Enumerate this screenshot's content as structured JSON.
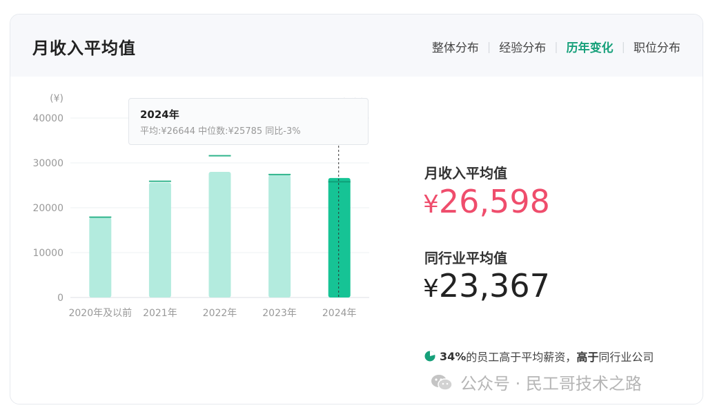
{
  "header": {
    "title": "月收入平均值",
    "tabs": [
      {
        "label": "整体分布",
        "active": false
      },
      {
        "label": "经验分布",
        "active": false
      },
      {
        "label": "历年变化",
        "active": true
      },
      {
        "label": "职位分布",
        "active": false
      }
    ]
  },
  "tooltip": {
    "title": "2024年",
    "body": "平均:¥26644  中位数:¥25785  同比-3%"
  },
  "stats": {
    "avg_label": "月收入平均值",
    "avg_value": "26,598",
    "industry_label": "同行业平均值",
    "industry_value": "23,367",
    "currency": "¥"
  },
  "note": {
    "percent": "34%",
    "text1": "的员工高于平均薪资，",
    "bold": "高于",
    "text2": "同行业公司"
  },
  "watermark": {
    "text": "公众号 · 民工哥技术之路",
    "icon": "wechat-icon"
  },
  "colors": {
    "bar": "#b3ebde",
    "bar_active": "#16c395",
    "median": "#2fb48b",
    "accent": "#16a07a",
    "avg_value": "#ef4d6c"
  },
  "chart_data": {
    "type": "bar",
    "unit": "(¥)",
    "categories": [
      "2020年及以前",
      "2021年",
      "2022年",
      "2023年",
      "2024年"
    ],
    "series": [
      {
        "values": [
          17800,
          25600,
          28000,
          27300,
          26644
        ]
      },
      {
        "name": "中位数",
        "values": [
          17900,
          25900,
          31600,
          27400,
          25785
        ]
      }
    ],
    "ylim": [
      0,
      40000
    ],
    "yticks": [
      0,
      10000,
      20000,
      30000,
      40000
    ],
    "active_index": 4,
    "legend": "top-right",
    "grid": true
  }
}
